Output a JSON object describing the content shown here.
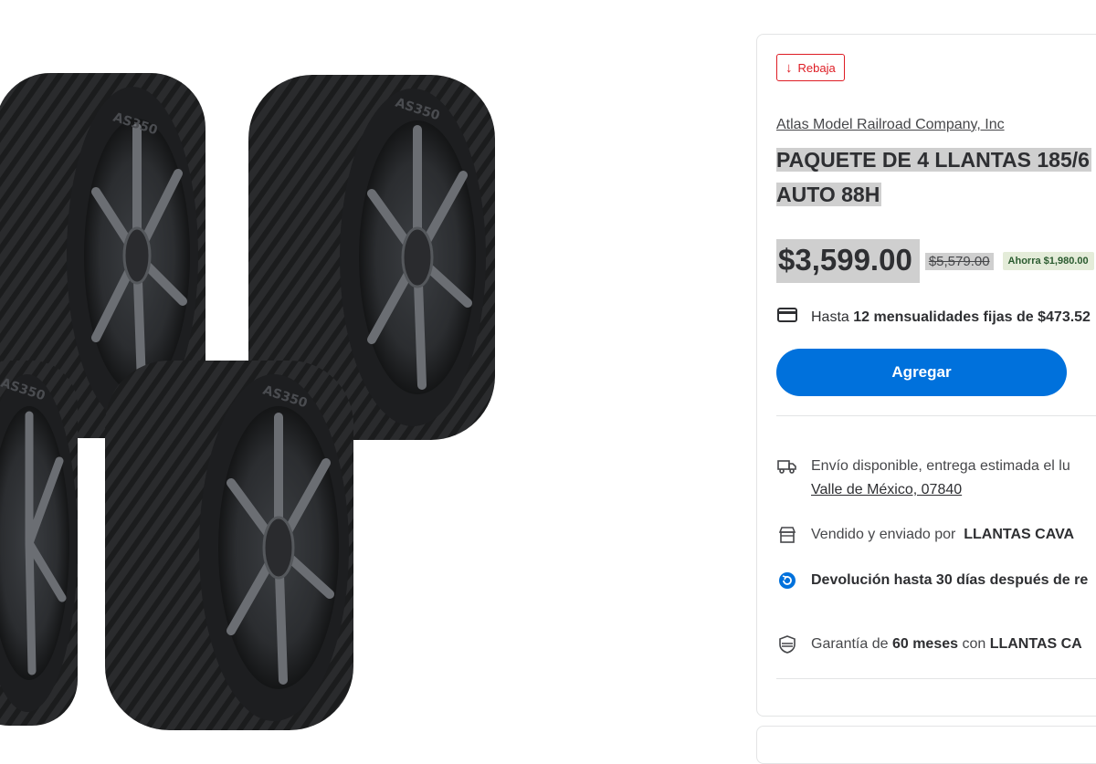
{
  "product_image": {
    "tire_sidewall_text": "AS350"
  },
  "badge": {
    "icon": "arrow-down-icon",
    "label": "Rebaja"
  },
  "seller_link": "Atlas Model Railroad Company, Inc",
  "title": {
    "line1": "PAQUETE DE 4 LLANTAS 185/6",
    "line2": "AUTO 88H"
  },
  "pricing": {
    "price": "$3,599.00",
    "old_price": "$5,579.00",
    "savings": "Ahorra $1,980.00"
  },
  "installments": {
    "icon": "credit-card-icon",
    "prefix": "Hasta ",
    "bold": "12 mensualidades fijas de $473.52"
  },
  "add_button": "Agregar",
  "shipping": {
    "icon": "truck-icon",
    "text": "Envío disponible, entrega estimada el lu",
    "location": "Valle de México, 07840"
  },
  "sold_by": {
    "icon": "store-icon",
    "prefix": "Vendido y enviado por",
    "seller": "LLANTAS CAVA"
  },
  "returns": {
    "icon": "return-icon",
    "text": "Devolución hasta 30 días después de re"
  },
  "warranty": {
    "icon": "shield-icon",
    "prefix": "Garantía de ",
    "months": "60 meses",
    "middle": " con ",
    "seller": "LLANTAS CA"
  },
  "colors": {
    "accent_blue": "#0071dc",
    "sale_red": "#de1c24",
    "highlight_gray": "#cfcfcf"
  }
}
